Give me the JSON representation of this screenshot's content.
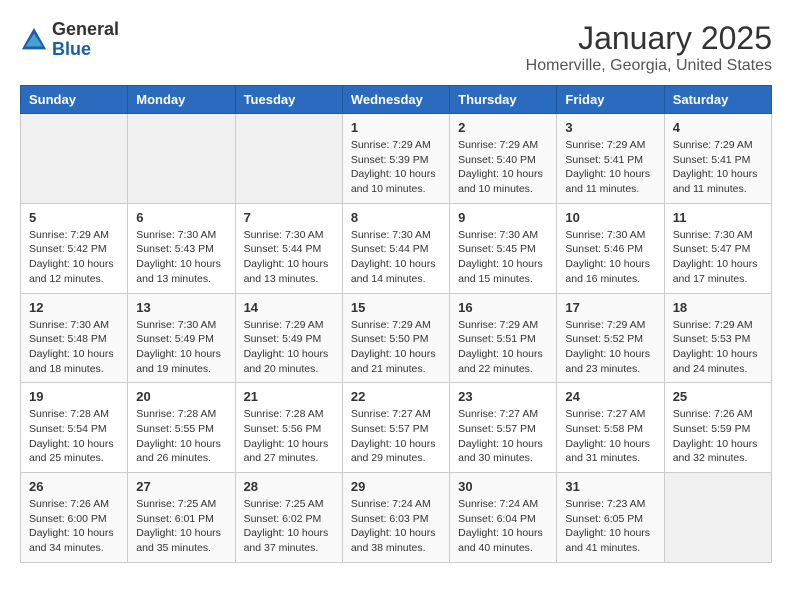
{
  "header": {
    "logo_general": "General",
    "logo_blue": "Blue",
    "title": "January 2025",
    "subtitle": "Homerville, Georgia, United States"
  },
  "calendar": {
    "days_of_week": [
      "Sunday",
      "Monday",
      "Tuesday",
      "Wednesday",
      "Thursday",
      "Friday",
      "Saturday"
    ],
    "weeks": [
      [
        {
          "day": "",
          "info": ""
        },
        {
          "day": "",
          "info": ""
        },
        {
          "day": "",
          "info": ""
        },
        {
          "day": "1",
          "info": "Sunrise: 7:29 AM\nSunset: 5:39 PM\nDaylight: 10 hours\nand 10 minutes."
        },
        {
          "day": "2",
          "info": "Sunrise: 7:29 AM\nSunset: 5:40 PM\nDaylight: 10 hours\nand 10 minutes."
        },
        {
          "day": "3",
          "info": "Sunrise: 7:29 AM\nSunset: 5:41 PM\nDaylight: 10 hours\nand 11 minutes."
        },
        {
          "day": "4",
          "info": "Sunrise: 7:29 AM\nSunset: 5:41 PM\nDaylight: 10 hours\nand 11 minutes."
        }
      ],
      [
        {
          "day": "5",
          "info": "Sunrise: 7:29 AM\nSunset: 5:42 PM\nDaylight: 10 hours\nand 12 minutes."
        },
        {
          "day": "6",
          "info": "Sunrise: 7:30 AM\nSunset: 5:43 PM\nDaylight: 10 hours\nand 13 minutes."
        },
        {
          "day": "7",
          "info": "Sunrise: 7:30 AM\nSunset: 5:44 PM\nDaylight: 10 hours\nand 13 minutes."
        },
        {
          "day": "8",
          "info": "Sunrise: 7:30 AM\nSunset: 5:44 PM\nDaylight: 10 hours\nand 14 minutes."
        },
        {
          "day": "9",
          "info": "Sunrise: 7:30 AM\nSunset: 5:45 PM\nDaylight: 10 hours\nand 15 minutes."
        },
        {
          "day": "10",
          "info": "Sunrise: 7:30 AM\nSunset: 5:46 PM\nDaylight: 10 hours\nand 16 minutes."
        },
        {
          "day": "11",
          "info": "Sunrise: 7:30 AM\nSunset: 5:47 PM\nDaylight: 10 hours\nand 17 minutes."
        }
      ],
      [
        {
          "day": "12",
          "info": "Sunrise: 7:30 AM\nSunset: 5:48 PM\nDaylight: 10 hours\nand 18 minutes."
        },
        {
          "day": "13",
          "info": "Sunrise: 7:30 AM\nSunset: 5:49 PM\nDaylight: 10 hours\nand 19 minutes."
        },
        {
          "day": "14",
          "info": "Sunrise: 7:29 AM\nSunset: 5:49 PM\nDaylight: 10 hours\nand 20 minutes."
        },
        {
          "day": "15",
          "info": "Sunrise: 7:29 AM\nSunset: 5:50 PM\nDaylight: 10 hours\nand 21 minutes."
        },
        {
          "day": "16",
          "info": "Sunrise: 7:29 AM\nSunset: 5:51 PM\nDaylight: 10 hours\nand 22 minutes."
        },
        {
          "day": "17",
          "info": "Sunrise: 7:29 AM\nSunset: 5:52 PM\nDaylight: 10 hours\nand 23 minutes."
        },
        {
          "day": "18",
          "info": "Sunrise: 7:29 AM\nSunset: 5:53 PM\nDaylight: 10 hours\nand 24 minutes."
        }
      ],
      [
        {
          "day": "19",
          "info": "Sunrise: 7:28 AM\nSunset: 5:54 PM\nDaylight: 10 hours\nand 25 minutes."
        },
        {
          "day": "20",
          "info": "Sunrise: 7:28 AM\nSunset: 5:55 PM\nDaylight: 10 hours\nand 26 minutes."
        },
        {
          "day": "21",
          "info": "Sunrise: 7:28 AM\nSunset: 5:56 PM\nDaylight: 10 hours\nand 27 minutes."
        },
        {
          "day": "22",
          "info": "Sunrise: 7:27 AM\nSunset: 5:57 PM\nDaylight: 10 hours\nand 29 minutes."
        },
        {
          "day": "23",
          "info": "Sunrise: 7:27 AM\nSunset: 5:57 PM\nDaylight: 10 hours\nand 30 minutes."
        },
        {
          "day": "24",
          "info": "Sunrise: 7:27 AM\nSunset: 5:58 PM\nDaylight: 10 hours\nand 31 minutes."
        },
        {
          "day": "25",
          "info": "Sunrise: 7:26 AM\nSunset: 5:59 PM\nDaylight: 10 hours\nand 32 minutes."
        }
      ],
      [
        {
          "day": "26",
          "info": "Sunrise: 7:26 AM\nSunset: 6:00 PM\nDaylight: 10 hours\nand 34 minutes."
        },
        {
          "day": "27",
          "info": "Sunrise: 7:25 AM\nSunset: 6:01 PM\nDaylight: 10 hours\nand 35 minutes."
        },
        {
          "day": "28",
          "info": "Sunrise: 7:25 AM\nSunset: 6:02 PM\nDaylight: 10 hours\nand 37 minutes."
        },
        {
          "day": "29",
          "info": "Sunrise: 7:24 AM\nSunset: 6:03 PM\nDaylight: 10 hours\nand 38 minutes."
        },
        {
          "day": "30",
          "info": "Sunrise: 7:24 AM\nSunset: 6:04 PM\nDaylight: 10 hours\nand 40 minutes."
        },
        {
          "day": "31",
          "info": "Sunrise: 7:23 AM\nSunset: 6:05 PM\nDaylight: 10 hours\nand 41 minutes."
        },
        {
          "day": "",
          "info": ""
        }
      ]
    ]
  }
}
